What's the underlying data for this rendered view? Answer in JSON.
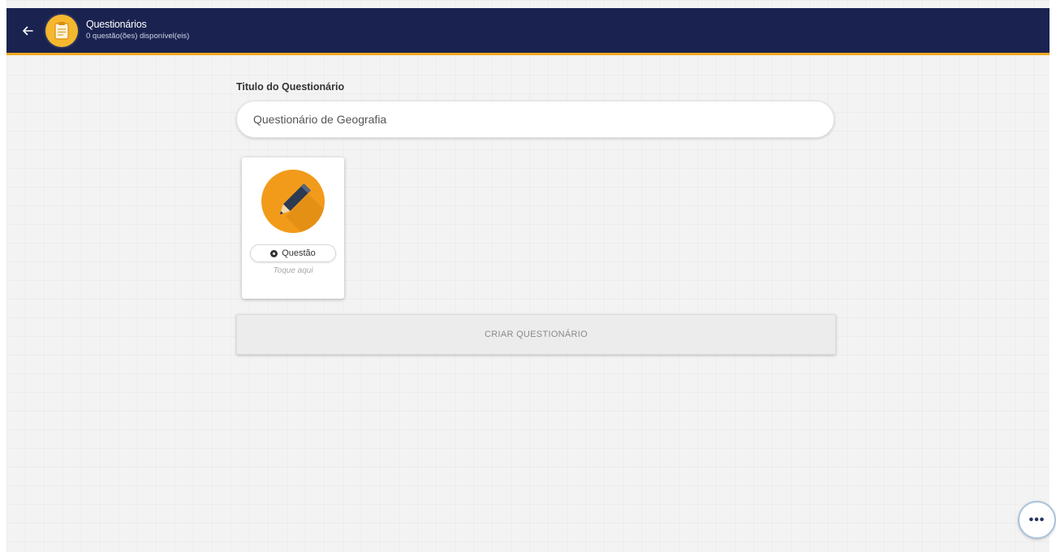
{
  "appbar": {
    "title": "Questionários",
    "subtitle": "0 questão(ões) disponível(eis)",
    "back_icon": "arrow-left-icon",
    "app_icon": "clipboard-icon",
    "colors": {
      "background": "#1a2350",
      "accent": "#f2a81d",
      "icon_bg": "#f5b72e"
    }
  },
  "form": {
    "title_label": "Titulo do Questionário",
    "title_value": "Questionário de Geografia",
    "question_card": {
      "icon": "pencil-icon",
      "chip_label": "Questão",
      "chip_icon": "dot-icon",
      "hint": "Toque aqui",
      "icon_bg": "#f29b1a"
    },
    "create_button": "CRIAR QUESTIONÁRIO"
  },
  "fab": {
    "label": "•••",
    "icon": "more-icon"
  }
}
